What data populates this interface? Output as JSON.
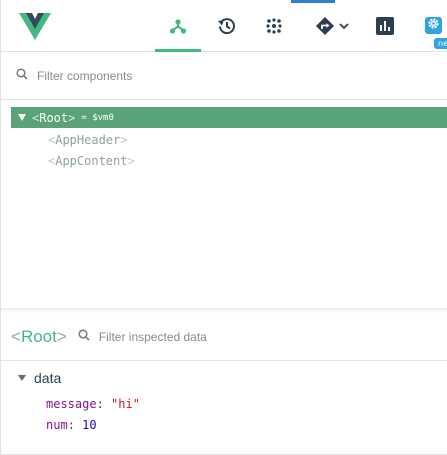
{
  "colors": {
    "accent": "#42b983",
    "selected_row": "#5aa378",
    "settings_blue": "#2ea5dd"
  },
  "toolbar": {
    "tools": [
      {
        "name": "components",
        "icon": "components-tree-icon",
        "active": true
      },
      {
        "name": "timeline",
        "icon": "history-icon"
      },
      {
        "name": "vuex",
        "icon": "dots-grid-icon"
      },
      {
        "name": "routing",
        "icon": "route-sign-icon"
      },
      {
        "name": "performance",
        "icon": "bar-chart-icon"
      },
      {
        "name": "settings",
        "icon": "gear-icon"
      }
    ],
    "new_badge": "ne"
  },
  "components_filter": {
    "placeholder": "Filter components"
  },
  "tree": {
    "root": {
      "open": "<",
      "name": "Root",
      "close": ">",
      "vm_ref": "= $vm0"
    },
    "children": [
      {
        "open": "<",
        "name": "AppHeader",
        "close": ">"
      },
      {
        "open": "<",
        "name": "AppContent",
        "close": ">"
      }
    ]
  },
  "inspector": {
    "title": {
      "open": "<",
      "name": "Root",
      "close": ">"
    },
    "filter_placeholder": "Filter inspected data",
    "section": "data",
    "props": [
      {
        "key": "message",
        "value": "\"hi\""
      },
      {
        "key": "num",
        "value": "10"
      }
    ]
  }
}
